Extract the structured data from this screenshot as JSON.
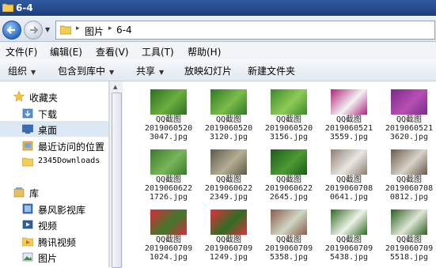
{
  "window": {
    "title": "6-4"
  },
  "address": {
    "crumbs": [
      "图片",
      "6-4"
    ]
  },
  "menu": [
    "文件(F)",
    "编辑(E)",
    "查看(V)",
    "工具(T)",
    "帮助(H)"
  ],
  "toolbar": {
    "organize": "组织",
    "include": "包含到库中",
    "share": "共享",
    "slideshow": "放映幻灯片",
    "newfolder": "新建文件夹"
  },
  "nav": {
    "favorites": "收藏夹",
    "downloads": "下载",
    "desktop": "桌面",
    "recent": "最近访问的位置",
    "folder2345": "2345Downloads",
    "libraries": "库",
    "storm": "暴风影视库",
    "video": "视频",
    "tencent": "腾讯视频",
    "pictures": "图片"
  },
  "files": [
    {
      "l1": "QQ截图",
      "l2": "2019060520",
      "l3": "3047.jpg",
      "c1": "#2e6e22",
      "c2": "#6cae3f"
    },
    {
      "l1": "QQ截图",
      "l2": "2019060520",
      "l3": "3120.jpg",
      "c1": "#2f7a26",
      "c2": "#7dbb4a"
    },
    {
      "l1": "QQ截图",
      "l2": "2019060520",
      "l3": "3156.jpg",
      "c1": "#3a8a2c",
      "c2": "#8fca57"
    },
    {
      "l1": "QQ截图",
      "l2": "2019060521",
      "l3": "3559.jpg",
      "c1": "#b0247a",
      "c2": "#f2f2f2"
    },
    {
      "l1": "QQ截图",
      "l2": "2019060521",
      "l3": "3620.jpg",
      "c1": "#7a2a8a",
      "c2": "#b84fb5"
    },
    {
      "l1": "QQ截图",
      "l2": "2019060622",
      "l3": "1726.jpg",
      "c1": "#3a7a2c",
      "c2": "#7ab55a"
    },
    {
      "l1": "QQ截图",
      "l2": "2019060622",
      "l3": "2349.jpg",
      "c1": "#5e5a48",
      "c2": "#b5ad94"
    },
    {
      "l1": "QQ截图",
      "l2": "2019060622",
      "l3": "2645.jpg",
      "c1": "#1f5a1c",
      "c2": "#4d9a33"
    },
    {
      "l1": "QQ截图",
      "l2": "2019060708",
      "l3": "0641.jpg",
      "c1": "#8c7e70",
      "c2": "#e9e6e1"
    },
    {
      "l1": "QQ截图",
      "l2": "2019060708",
      "l3": "0812.jpg",
      "c1": "#6a5a4a",
      "c2": "#d8d2c8"
    },
    {
      "l1": "QQ截图",
      "l2": "2019060709",
      "l3": "1024.jpg",
      "c1": "#d82a3a",
      "c2": "#3f7a2c"
    },
    {
      "l1": "QQ截图",
      "l2": "2019060709",
      "l3": "1249.jpg",
      "c1": "#e0303c",
      "c2": "#2f6e25"
    },
    {
      "l1": "QQ截图",
      "l2": "2019060709",
      "l3": "5358.jpg",
      "c1": "#8a5a4a",
      "c2": "#cfd6c4"
    },
    {
      "l1": "QQ截图",
      "l2": "2019060709",
      "l3": "5438.jpg",
      "c1": "#2f6a24",
      "c2": "#eef2e8"
    },
    {
      "l1": "QQ截图",
      "l2": "2019060709",
      "l3": "5518.jpg",
      "c1": "#2a5e22",
      "c2": "#dfe6d6"
    }
  ]
}
